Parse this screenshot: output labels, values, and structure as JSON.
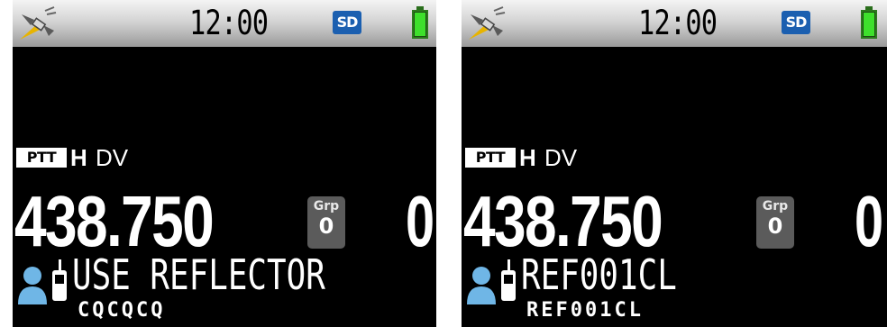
{
  "screens": [
    {
      "clock": "12:00",
      "sd_label": "SD",
      "ptt_label": "PTT",
      "power": "H",
      "mode": "DV",
      "frequency": "438.750",
      "grp_label": "Grp",
      "grp_value": "0",
      "channel": "0",
      "destination": "USE REFLECTOR",
      "destination_sub": "CQCQCQ"
    },
    {
      "clock": "12:00",
      "sd_label": "SD",
      "ptt_label": "PTT",
      "power": "H",
      "mode": "DV",
      "frequency": "438.750",
      "grp_label": "Grp",
      "grp_value": "0",
      "channel": "0",
      "destination": "REF001CL",
      "destination_sub": "REF001CL"
    }
  ],
  "icons": {
    "gps": "gps-satellite-icon",
    "sd": "sd-card-icon",
    "battery": "battery-icon",
    "user": "user-radio-icon"
  },
  "colors": {
    "battery_fill": "#3ee02c",
    "sd_badge": "#1b5fb0",
    "grp_badge": "#5b5b5b",
    "user_icon": "#6fb6e6"
  }
}
